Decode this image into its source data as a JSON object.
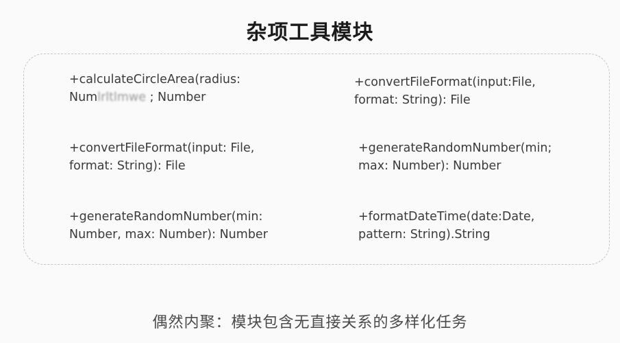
{
  "title": "杂项工具模块",
  "methods": [
    {
      "line1": "+calculateCircleArea(radius:",
      "line2_prefix": "Num",
      "line2_blurred": "lrltlmwe",
      "line2_suffix": " ; Number"
    },
    {
      "line1": "+convertFileFormat(input:File,",
      "line2": "format: String): File"
    },
    {
      "line1": "+convertFileFormat(input: File,",
      "line2": "format: String): File"
    },
    {
      "line1": "+generateRandomNumber(min;",
      "line2": "max: Number): Number"
    },
    {
      "line1": "+generateRandomNumber(min:",
      "line2": "Number, max: Number): Number"
    },
    {
      "line1": "+formatDateTime(date:Date,",
      "line2": "pattern: String).String"
    }
  ],
  "caption": "偶然内聚：模块包含无直接关系的多样化任务"
}
